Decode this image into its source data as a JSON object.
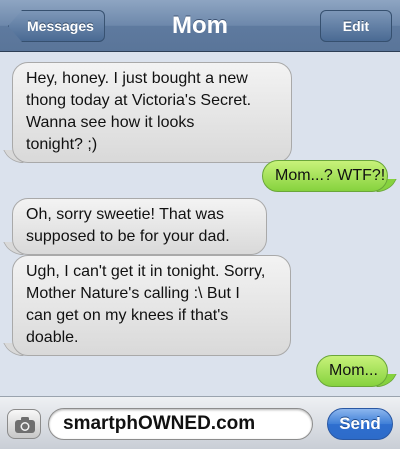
{
  "navbar": {
    "back_label": "Messages",
    "title": "Mom",
    "edit_label": "Edit"
  },
  "messages": [
    {
      "direction": "incoming",
      "lines": [
        "Hey, honey. I just bought a new",
        "thong today at Victoria's Secret.",
        "Wanna see how it looks",
        "tonight? ;)"
      ]
    },
    {
      "direction": "outgoing",
      "lines": [
        "Mom...? WTF?!"
      ]
    },
    {
      "direction": "incoming",
      "lines": [
        "Oh, sorry sweetie! That was",
        "supposed to be for your dad."
      ]
    },
    {
      "direction": "incoming",
      "lines": [
        "Ugh, I can't get it in tonight. Sorry,",
        "Mother Nature's calling :\\ But I",
        "can get on my knees if that's",
        "doable."
      ]
    },
    {
      "direction": "outgoing",
      "lines": [
        "Mom..."
      ]
    }
  ],
  "composer": {
    "input_value": "smartphOWNED.com",
    "send_label": "Send",
    "camera_icon": "camera-icon"
  },
  "colors": {
    "incoming_bubble": "#e6e6e6",
    "outgoing_bubble": "#9fe05a",
    "background": "#dbe2ed",
    "send_button": "#3a78d4"
  }
}
